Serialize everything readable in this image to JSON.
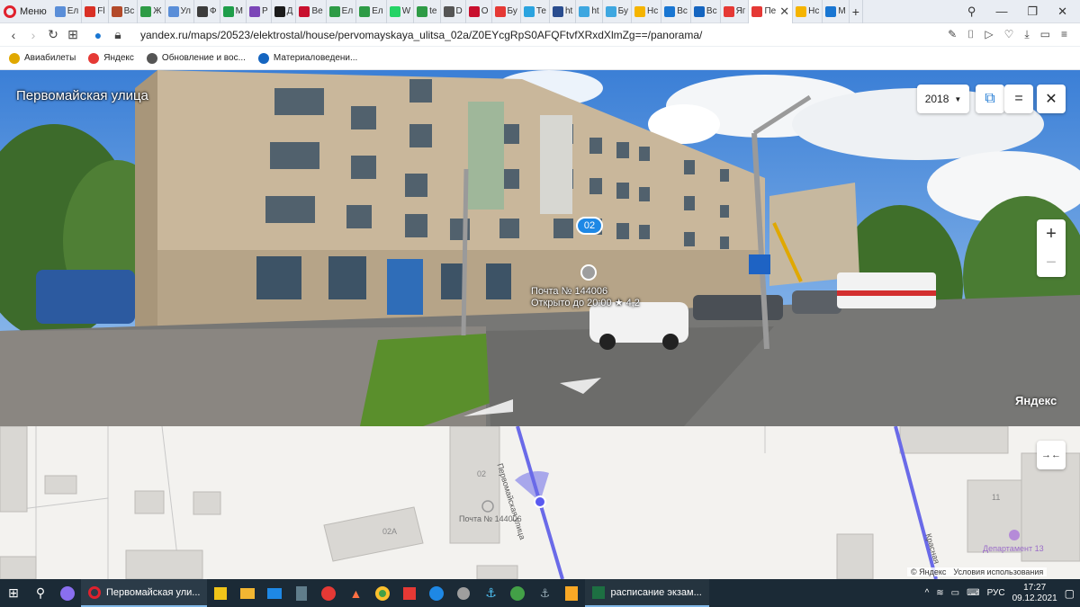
{
  "browser": {
    "menu_label": "Меню",
    "tabs": [
      {
        "label": "Ел",
        "color": "#5a8ed8"
      },
      {
        "label": "Fl",
        "color": "#d93025"
      },
      {
        "label": "Вс",
        "color": "#b34a2a"
      },
      {
        "label": "Ж",
        "color": "#2e9b46"
      },
      {
        "label": "Ул",
        "color": "#5a8ed8"
      },
      {
        "label": "Ф",
        "color": "#3c3c3c"
      },
      {
        "label": "М",
        "color": "#1f9e4a"
      },
      {
        "label": "Р",
        "color": "#7b46b7"
      },
      {
        "label": "Д",
        "color": "#1b1b1b"
      },
      {
        "label": "Ве",
        "color": "#c8102e"
      },
      {
        "label": "Ел",
        "color": "#2e9b46"
      },
      {
        "label": "Ел",
        "color": "#2e9b46"
      },
      {
        "label": "W",
        "color": "#25d366"
      },
      {
        "label": "te",
        "color": "#2e9b46"
      },
      {
        "label": "D",
        "color": "#555"
      },
      {
        "label": "О",
        "color": "#c8102e"
      },
      {
        "label": "Бу",
        "color": "#e53935"
      },
      {
        "label": "Те",
        "color": "#2aa3df"
      },
      {
        "label": "ht",
        "color": "#2a4d8f"
      },
      {
        "label": "ht",
        "color": "#3ea7e0"
      },
      {
        "label": "Бу",
        "color": "#3ea7e0"
      },
      {
        "label": "Нс",
        "color": "#f5b400"
      },
      {
        "label": "Вс",
        "color": "#1976d2"
      },
      {
        "label": "Вс",
        "color": "#1565c0"
      },
      {
        "label": "Яг",
        "color": "#e53935"
      },
      {
        "label": "Пе",
        "color": "#e53935",
        "active": true
      },
      {
        "label": "Нс",
        "color": "#f5b400"
      },
      {
        "label": "М",
        "color": "#1976d2"
      }
    ],
    "new_tab_label": "+",
    "url": "yandex.ru/maps/20523/elektrostal/house/pervomayskaya_ulitsa_02a/Z0EYcgRpS0AFQFtvfXRxdXlmZg==/panorama/",
    "bookmarks": [
      {
        "label": "Авиабилеты",
        "icon": "plane-icon"
      },
      {
        "label": "Яндекс",
        "icon": "yandex-icon"
      },
      {
        "label": "Обновление и вос...",
        "icon": "update-icon"
      },
      {
        "label": "Материаловедени...",
        "icon": "gear-icon"
      }
    ]
  },
  "panorama": {
    "street_name": "Первомайская улица",
    "year": "2018",
    "house_badge": "02",
    "poi_name": "Почта № 144006",
    "poi_status": "Открыто до 20:00 ★ 4,2",
    "watermark": "Яндекс",
    "zoom_in": "+",
    "zoom_out": "−",
    "close": "✕",
    "menu": "="
  },
  "map": {
    "street_label": "Первомайская улица",
    "street_label_2": "Красная",
    "house_02": "02",
    "house_02a": "02А",
    "house_11": "11",
    "poi_label": "Почта № 144006",
    "dept_label": "Департамент 13",
    "collapse_label": "→←",
    "copyright": "© Яндекс",
    "terms": "Условия использования"
  },
  "taskbar": {
    "active_app": "Первомайская ули...",
    "excel_app": "расписание экзам...",
    "lang": "РУС",
    "time": "17:27",
    "date": "09.12.2021"
  }
}
